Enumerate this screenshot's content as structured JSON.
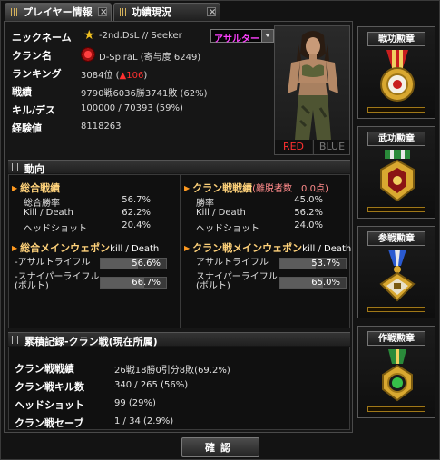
{
  "tabs": [
    {
      "label": "プレイヤー情報"
    },
    {
      "label": "功績現況"
    }
  ],
  "profile": {
    "nickname_label": "ニックネーム",
    "nickname": "-2nd.DsL // Seeker",
    "class_selected": "アサルター",
    "clan_label": "クラン名",
    "clan": "D-SpiraL (寄与度 6249)",
    "ranking_label": "ランキング",
    "ranking": "3084位 (",
    "ranking_change": "▲106",
    "ranking_close": ")",
    "record_label": "戦績",
    "record": "9790戦6036勝3741敗 (62%)",
    "kd_label": "キル/デス",
    "kd": "100000 / 70393 (59%)",
    "exp_label": "経験値",
    "exp": "8118263",
    "team_red": "RED",
    "team_blue": "BLUE"
  },
  "trend": {
    "header": "動向",
    "overall": {
      "title": "総合戦績",
      "rows": [
        {
          "label": "総合勝率",
          "value": "56.7%"
        },
        {
          "label": "Kill / Death",
          "value": "62.2%"
        },
        {
          "label": "ヘッドショット",
          "value": "20.4%"
        }
      ]
    },
    "clan": {
      "title": "クラン戦戦績",
      "sub": "(離脱者数　0.0点)",
      "rows": [
        {
          "label": "勝率",
          "value": "45.0%"
        },
        {
          "label": "Kill / Death",
          "value": "56.2%"
        },
        {
          "label": "ヘッドショット",
          "value": "24.0%"
        }
      ]
    },
    "overall_weapon": {
      "title": "総合メインウェポン",
      "sub": "kill / Death",
      "rows": [
        {
          "label": "-アサルトライフル",
          "value": "56.6%",
          "fill": 0.566
        },
        {
          "label": "-スナイパーライフル\n(ボルト)",
          "value": "66.7%",
          "fill": 0.667
        }
      ]
    },
    "clan_weapon": {
      "title": "クラン戦メインウェポン",
      "sub": "kill / Death",
      "rows": [
        {
          "label": "アサルトライフル",
          "value": "53.7%",
          "fill": 0.537
        },
        {
          "label": "スナイパーライフル\n(ボルト)",
          "value": "65.0%",
          "fill": 0.65
        }
      ]
    }
  },
  "clan_record": {
    "header": "累積記録-クラン戦(現在所属)",
    "rows": [
      {
        "label": "クラン戦戦績",
        "value": "26戦18勝0引分8敗(69.2%)"
      },
      {
        "label": "クラン戦キル数",
        "value": "340 / 265 (56%)"
      },
      {
        "label": "ヘッドショット",
        "value": "99 (29%)"
      },
      {
        "label": "クラン戦セーブ",
        "value": "1 / 34 (2.9%)"
      }
    ]
  },
  "medals": [
    {
      "title": "戦功勲章",
      "icon": "medal-red-ribbon-icon"
    },
    {
      "title": "武功勲章",
      "icon": "medal-green-ribbon-icon"
    },
    {
      "title": "参戦勲章",
      "icon": "medal-blue-ribbon-icon"
    },
    {
      "title": "作戦勲章",
      "icon": "medal-green-gem-icon"
    }
  ],
  "confirm_label": "確認"
}
